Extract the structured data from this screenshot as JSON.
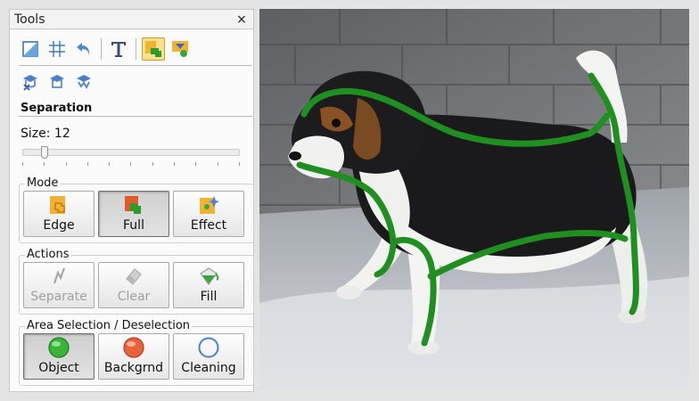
{
  "panel": {
    "title": "Tools",
    "close_label": "×"
  },
  "toolbar": {
    "row1_icons": [
      "crop-icon",
      "grid-icon",
      "undo-icon",
      "text-icon",
      "separation-tool-icon",
      "effect-tool-icon"
    ],
    "row2_icons": [
      "remove-hat-icon",
      "hat-icon",
      "hat-pattern-icon"
    ]
  },
  "separation": {
    "heading": "Separation",
    "size_label": "Size: 12",
    "size_value": 12
  },
  "mode": {
    "legend": "Mode",
    "buttons": [
      {
        "label": "Edge",
        "icon": "edge-mode-icon",
        "state": "normal"
      },
      {
        "label": "Full",
        "icon": "full-mode-icon",
        "state": "pressed"
      },
      {
        "label": "Effect",
        "icon": "effect-mode-icon",
        "state": "normal"
      }
    ]
  },
  "actions": {
    "legend": "Actions",
    "buttons": [
      {
        "label": "Separate",
        "icon": "separate-icon",
        "state": "disabled"
      },
      {
        "label": "Clear",
        "icon": "eraser-icon",
        "state": "disabled"
      },
      {
        "label": "Fill",
        "icon": "fill-bucket-icon",
        "state": "normal"
      }
    ]
  },
  "area": {
    "legend": "Area Selection / Deselection",
    "buttons": [
      {
        "label": "Object",
        "icon": "object-circle-icon",
        "state": "pressed"
      },
      {
        "label": "Backgrnd",
        "icon": "background-circle-icon",
        "state": "normal"
      },
      {
        "label": "Cleaning",
        "icon": "cleaning-circle-icon",
        "state": "normal"
      }
    ]
  },
  "colors": {
    "stroke": "#1f8f1f",
    "accent": "#ffe08a"
  }
}
